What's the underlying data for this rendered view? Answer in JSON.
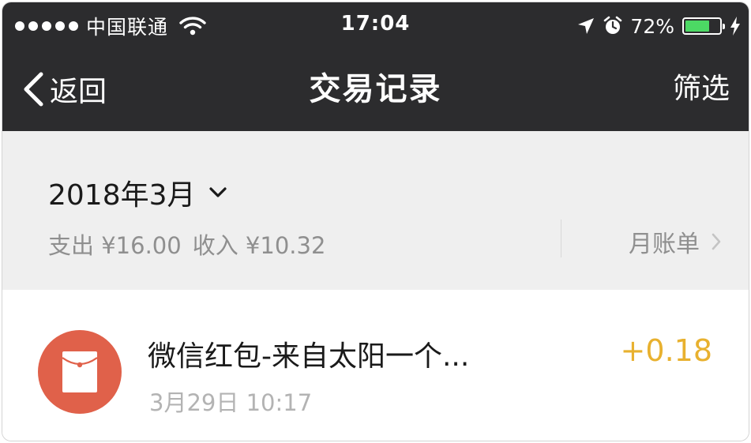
{
  "status_bar": {
    "carrier": "中国联通",
    "time": "17:04",
    "battery_percent": "72%",
    "battery_level": 0.72,
    "icons": [
      "signal-dots-icon",
      "wifi-icon",
      "location-arrow-icon",
      "alarm-clock-icon",
      "battery-icon",
      "charging-bolt-icon"
    ]
  },
  "nav": {
    "back_label": "返回",
    "title": "交易记录",
    "filter_label": "筛选"
  },
  "summary": {
    "month": "2018年3月",
    "expense": "支出 ¥16.00",
    "income": "收入 ¥10.32",
    "monthly_bill_label": "月账单"
  },
  "transactions": [
    {
      "icon": "red-packet-icon",
      "title": "微信红包-来自太阳一个...",
      "time": "3月29日 10:17",
      "amount": "+0.18"
    }
  ],
  "colors": {
    "header_bg": "#2c2c2e",
    "summary_bg": "#efefef",
    "red_packet": "#e0614a",
    "income_amount": "#e8b12f",
    "battery_fill": "#4cd964"
  }
}
